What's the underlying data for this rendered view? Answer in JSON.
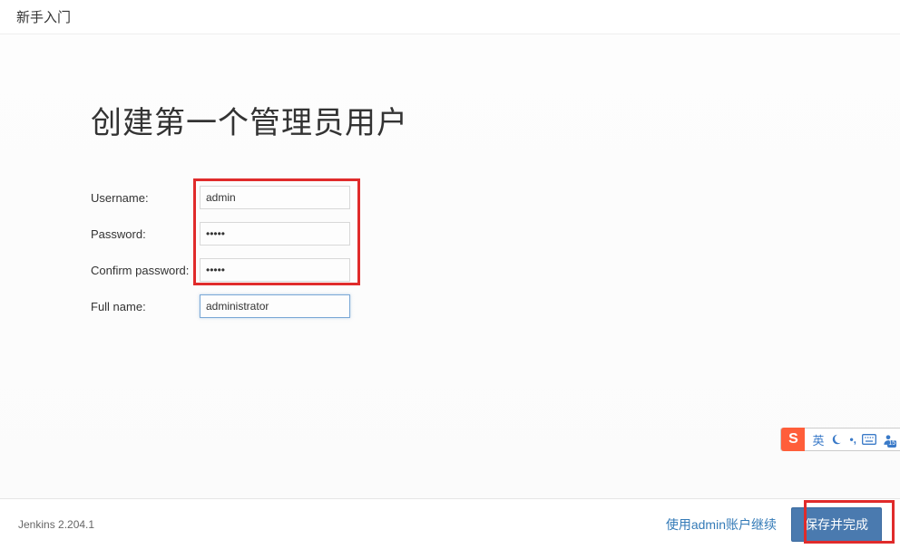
{
  "header": {
    "title": "新手入门"
  },
  "page": {
    "heading": "创建第一个管理员用户"
  },
  "form": {
    "username": {
      "label": "Username:",
      "value": "admin"
    },
    "password": {
      "label": "Password:",
      "value": "•••••"
    },
    "confirm_password": {
      "label": "Confirm password:",
      "value": "•••••"
    },
    "full_name": {
      "label": "Full name:",
      "value": "administrator"
    }
  },
  "footer": {
    "version": "Jenkins 2.204.1",
    "skip_label": "使用admin账户继续",
    "save_label": "保存并完成"
  },
  "ime": {
    "logo": "S",
    "lang": "英",
    "badge": "15"
  }
}
